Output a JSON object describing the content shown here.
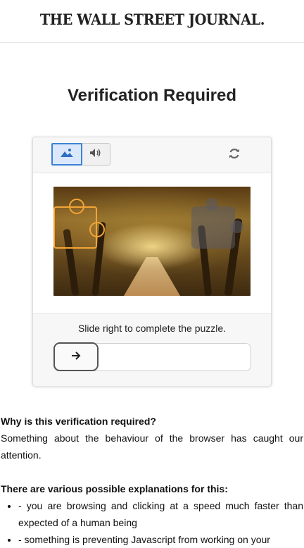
{
  "header": {
    "logo_text": "THE WALL STREET JOURNAL."
  },
  "page": {
    "title": "Verification Required"
  },
  "captcha": {
    "modes": [
      {
        "icon": "image-icon",
        "active": true
      },
      {
        "icon": "speaker-icon",
        "active": false
      }
    ],
    "refresh_icon": "refresh-icon",
    "instruction": "Slide right to complete the puzzle.",
    "slider_icon": "arrow-right-icon",
    "accent_color": "#3b82d6",
    "piece_outline_color": "#f3a536"
  },
  "info": {
    "q_heading": "Why is this verification required?",
    "q_text": "Something about the behaviour of the browser has caught our attention.",
    "reasons_heading": "There are various possible explanations for this:",
    "reasons": [
      "- you are browsing and clicking at a speed much faster than expected of a human being",
      "- something is preventing Javascript from working on your"
    ]
  }
}
